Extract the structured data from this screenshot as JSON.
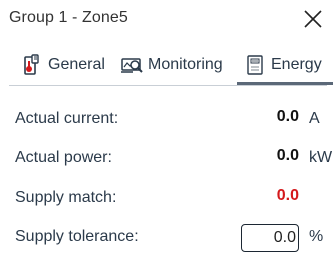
{
  "dialog": {
    "title": "Group 1 - Zone5"
  },
  "tabs": [
    {
      "label": "General",
      "icon": "thermostat-icon"
    },
    {
      "label": "Monitoring",
      "icon": "monitoring-icon"
    },
    {
      "label": "Energy",
      "icon": "energy-meter-icon",
      "active": true
    }
  ],
  "energy": {
    "actual_current": {
      "label": "Actual current:",
      "value": "0.0",
      "unit": "A"
    },
    "actual_power": {
      "label": "Actual power:",
      "value": "0.0",
      "unit": "kW"
    },
    "supply_match": {
      "label": "Supply match:",
      "value": "0.0",
      "color": "#d4191c"
    },
    "supply_tolerance": {
      "label": "Supply tolerance:",
      "value": "0.0",
      "unit": "%"
    }
  },
  "colors": {
    "active_tab_underline": "#5b6878",
    "alert": "#d4191c"
  }
}
